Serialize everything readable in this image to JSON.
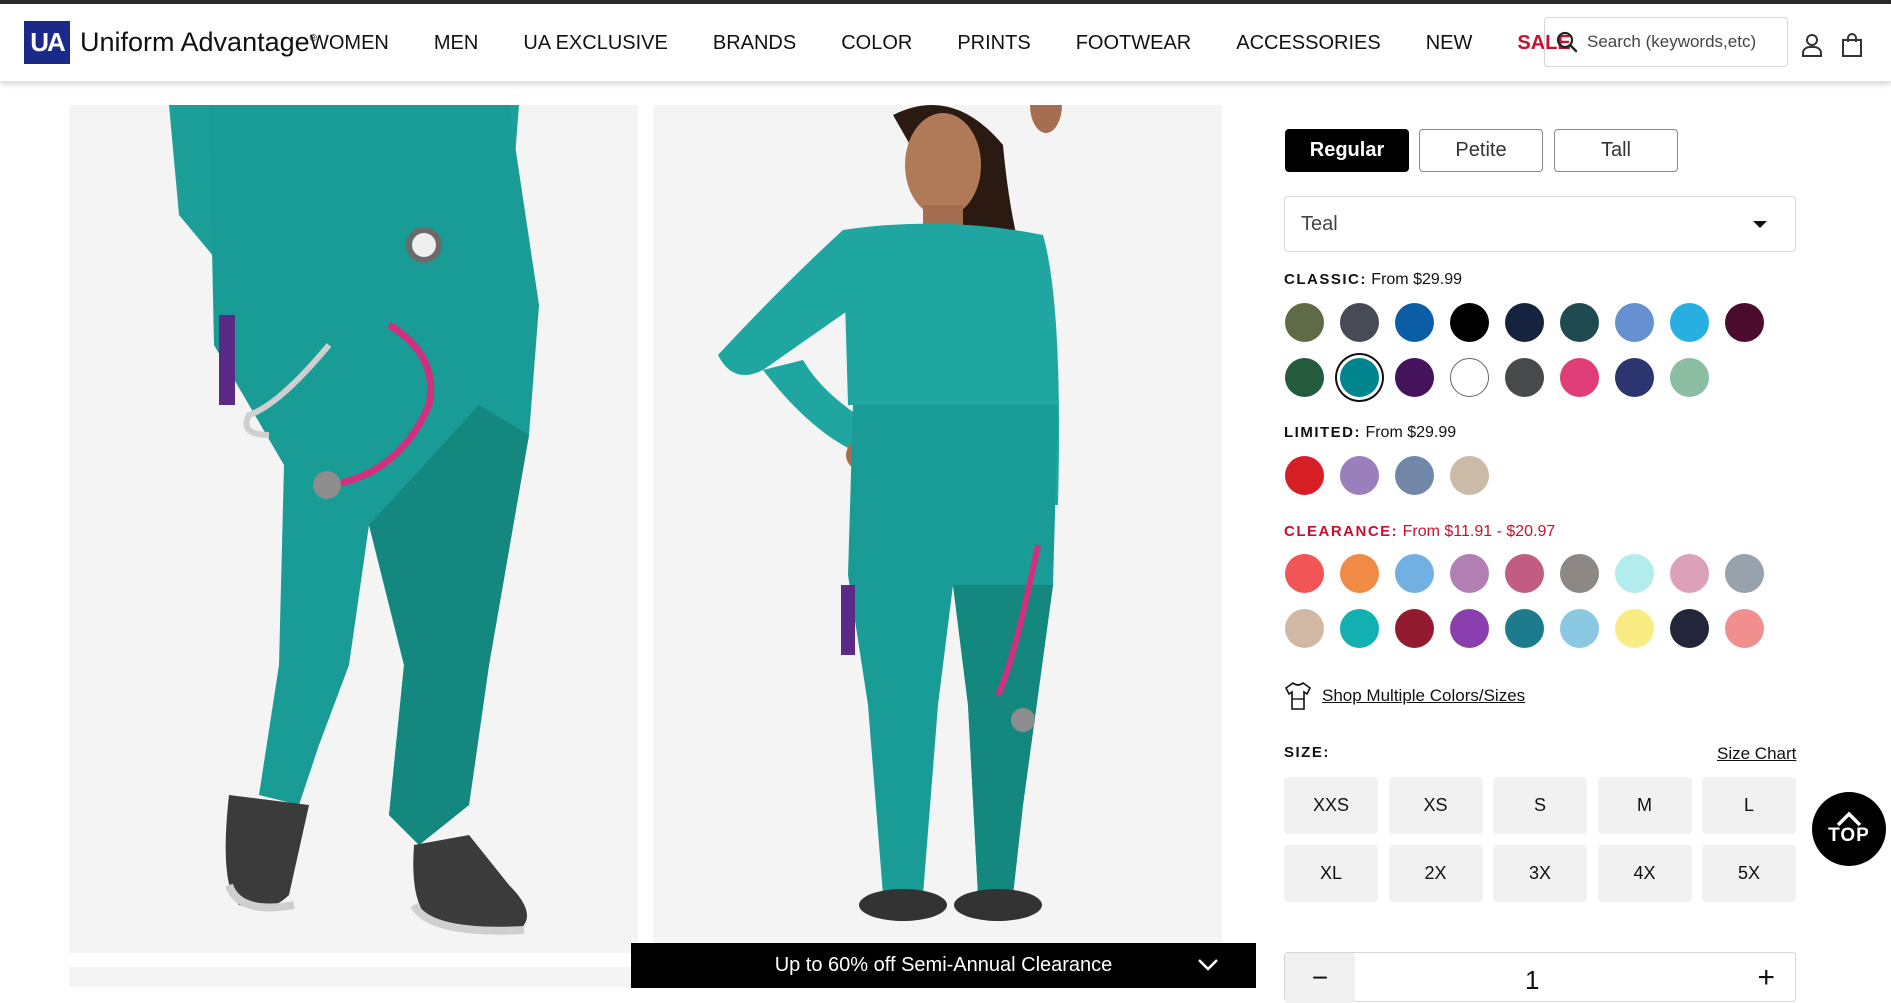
{
  "brand": {
    "mark": "UA",
    "name": "Uniform Advantage",
    "reg": "®"
  },
  "nav": [
    {
      "label": "WOMEN"
    },
    {
      "label": "MEN"
    },
    {
      "label": "UA EXCLUSIVE"
    },
    {
      "label": "BRANDS"
    },
    {
      "label": "COLOR"
    },
    {
      "label": "PRINTS"
    },
    {
      "label": "FOOTWEAR"
    },
    {
      "label": "ACCESSORIES"
    },
    {
      "label": "NEW"
    },
    {
      "label": "SALE"
    }
  ],
  "search": {
    "placeholder": "Search (keywords,etc)"
  },
  "icons": {
    "search": "search-icon",
    "account": "user-icon",
    "bag": "shopping-bag-icon",
    "shirt": "shirt-icon",
    "top": "chevron-up-icon",
    "promo": "chevron-down-icon"
  },
  "fit": {
    "options": [
      "Regular",
      "Petite",
      "Tall"
    ],
    "selected": "Regular"
  },
  "color_select": {
    "value": "Teal"
  },
  "groups": {
    "classic": {
      "label": "CLASSIC:",
      "price": "From $29.99",
      "swatches": [
        "#5f6b47",
        "#474b55",
        "#0b5ea6",
        "#000000",
        "#16233f",
        "#1e4a50",
        "#6591d0",
        "#26afe0",
        "#4b0c2e",
        "#245b3d",
        "#00858f",
        "#44135c",
        "#ffffff",
        "#48494b",
        "#e03c76",
        "#2c3570",
        "#8cbea4"
      ],
      "selected_index": 10
    },
    "limited": {
      "label": "LIMITED:",
      "price": "From $29.99",
      "swatches": [
        "#d81e25",
        "#9b7fbd",
        "#7287a7",
        "#cbbaa6"
      ]
    },
    "clearance": {
      "label": "CLEARANCE:",
      "price": "From $11.91 - $20.97",
      "swatches": [
        "#f25555",
        "#f08a45",
        "#72b0e2",
        "#b27fb5",
        "#c25c80",
        "#8d8884",
        "#b2ecec",
        "#dca1b8",
        "#97a2ad",
        "#d1b8a5",
        "#12b0b0",
        "#921b2f",
        "#8b3fae",
        "#1c7c8e",
        "#8bc9e3",
        "#f8ec82",
        "#23263a",
        "#f18f8f"
      ]
    }
  },
  "multi_link": "Shop Multiple Colors/Sizes",
  "size": {
    "label": "SIZE:",
    "chart_link": "Size Chart",
    "options": [
      "XXS",
      "XS",
      "S",
      "M",
      "L",
      "XL",
      "2X",
      "3X",
      "4X",
      "5X"
    ]
  },
  "quantity": {
    "value": "1",
    "minus": "−",
    "plus": "+"
  },
  "promo": {
    "text": "Up to 60% off Semi-Annual Clearance"
  },
  "top_button": {
    "label": "TOP"
  },
  "colors": {
    "brand": "#1b2a8a",
    "sale": "#c8102e",
    "product": "#1a9c96"
  }
}
